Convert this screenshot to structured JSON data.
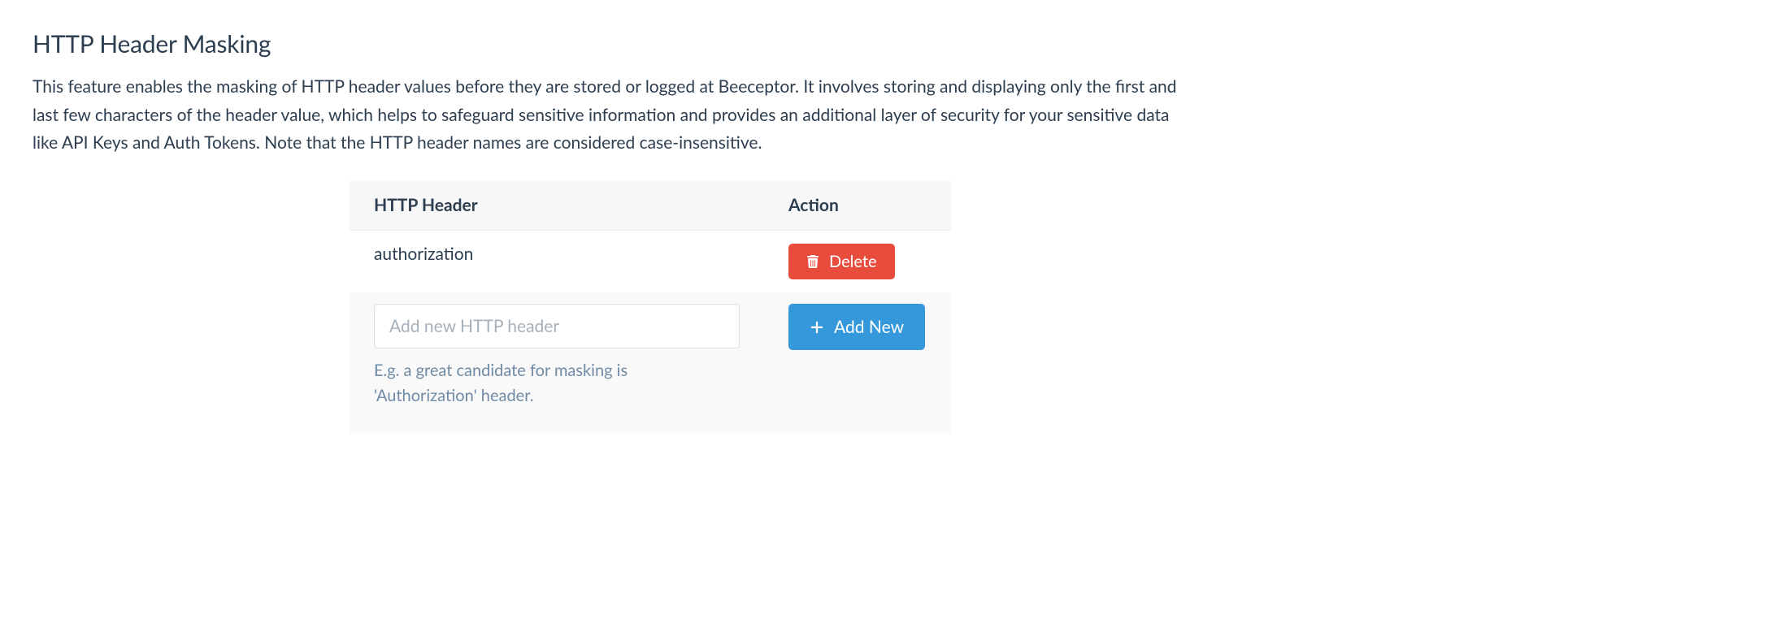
{
  "section": {
    "title": "HTTP Header Masking",
    "description": "This feature enables the masking of HTTP header values before they are stored or logged at Beeceptor. It involves storing and displaying only the first and last few characters of the header value, which helps to safeguard sensitive information and provides an additional layer of security for your sensitive data like API Keys and Auth Tokens. Note that the HTTP header names are considered case-insensitive."
  },
  "table": {
    "columns": {
      "header": "HTTP Header",
      "action": "Action"
    },
    "rows": [
      {
        "header": "authorization"
      }
    ],
    "delete_label": "Delete",
    "add_label": "Add New",
    "input_placeholder": "Add new HTTP header",
    "help_text": "E.g. a great candidate for masking is 'Authorization' header."
  }
}
